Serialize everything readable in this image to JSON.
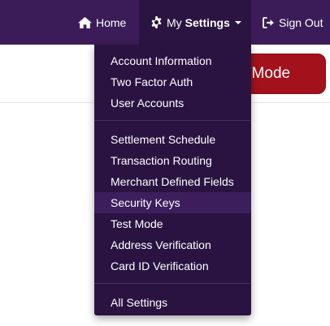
{
  "navbar": {
    "home_label": "Home",
    "settings_prefix": "My",
    "settings_label": "Settings",
    "signout_label": "Sign Out",
    "icons": [
      "home-icon",
      "gear-icon",
      "chevron-down-icon",
      "sign-out-icon"
    ]
  },
  "background": {
    "mode_button_label": "t Mode"
  },
  "dropdown": {
    "group1": [
      "Account Information",
      "Two Factor Auth",
      "User Accounts"
    ],
    "group2": [
      "Settlement Schedule",
      "Transaction Routing",
      "Merchant Defined Fields",
      "Security Keys",
      "Test Mode",
      "Address Verification",
      "Card ID Verification"
    ],
    "group3": [
      "All Settings"
    ],
    "highlighted_item": "Security Keys"
  },
  "colors": {
    "navbar": "#3b1c58",
    "dropdown": "#2a1341",
    "highlight": "#3d1e5c",
    "danger_button": "#a3111b"
  }
}
